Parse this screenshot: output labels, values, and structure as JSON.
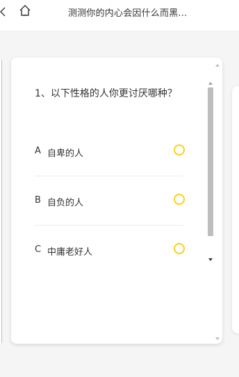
{
  "header": {
    "title": "测测你的内心会因什么而黑..."
  },
  "quiz": {
    "question": "1、以下性格的人你更讨厌哪种？",
    "options": [
      {
        "letter": "A",
        "text": "自卑的人"
      },
      {
        "letter": "B",
        "text": "自负的人"
      },
      {
        "letter": "C",
        "text": "中庸老好人"
      }
    ]
  },
  "icons": {
    "back": "chevron-left-icon",
    "home": "home-icon",
    "radio": "radio-unselected-icon"
  },
  "colors": {
    "accent": "#f7d21a",
    "background": "#f5f5f5",
    "card": "#ffffff",
    "text": "#333333",
    "scrollbar": "#bdbdbd"
  }
}
